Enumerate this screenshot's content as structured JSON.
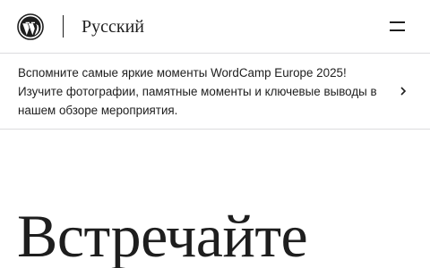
{
  "header": {
    "logo_icon": "wordpress-logo-icon",
    "site_language": "Русский",
    "menu_icon": "hamburger-menu-icon"
  },
  "banner": {
    "line1": "Вспомните самые яркие моменты WordCamp Europe 2025!",
    "line2": "Изучите фотографии, памятные моменты и ключевые выводы в",
    "line3": "нашем обзоре мероприятия.",
    "arrow_icon": "chevron-right-icon"
  },
  "hero": {
    "title": "Встречайте"
  },
  "colors": {
    "text": "#1e1e1e",
    "border": "#dcdcde",
    "background": "#ffffff"
  }
}
